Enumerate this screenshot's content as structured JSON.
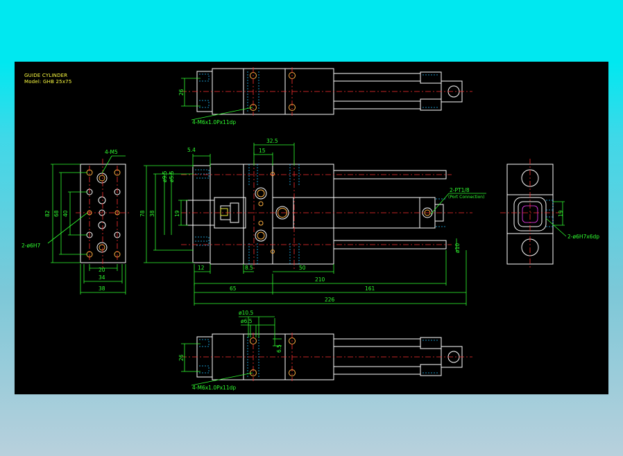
{
  "title": {
    "line1": "GUIDE CYLINDER",
    "line2": "Model: GHB 25x75"
  },
  "annotations": {
    "top_holes": "4-M6x1.0Px11dp",
    "bottom_holes": "4-M6x1.0Px11dp",
    "left_m5": "4-M5",
    "left_pin": "2-ø6H7",
    "right_pin": "2-ø6H7x6dp",
    "port_size": "2-PT1/8",
    "port_label": "(Port Connection)"
  },
  "dimensions": {
    "top_26": "26",
    "bot_26": "26",
    "bot_6_5": "6.5",
    "d_phi10_5": "ø10.5",
    "d_phi6_5": "ø6.5",
    "d_5_4": "5.4",
    "d_15": "15",
    "d_32_5": "32.5",
    "d_phi9_5": "ø9.5",
    "d_phi5_5": "ø5.5",
    "d_78": "78",
    "d_38": "38",
    "d_19": "19",
    "d_12": "12",
    "d_8_5": "8.5",
    "d_50": "50",
    "d_65": "65",
    "d_210": "210",
    "d_161": "161",
    "d_226": "226",
    "d_phi10": "ø10",
    "lv_82": "82",
    "lv_68": "68",
    "lv_40": "40",
    "lv_20": "20",
    "lv_34": "34",
    "lv_38": "38",
    "rv_19": "19"
  },
  "colors": {
    "outline": "#ffffff",
    "dimension": "#30ff30",
    "centerline": "#ff3030",
    "hidden": "#20c0ff",
    "hole": "#ffb040",
    "title": "#ffff40",
    "background": "#000000"
  }
}
